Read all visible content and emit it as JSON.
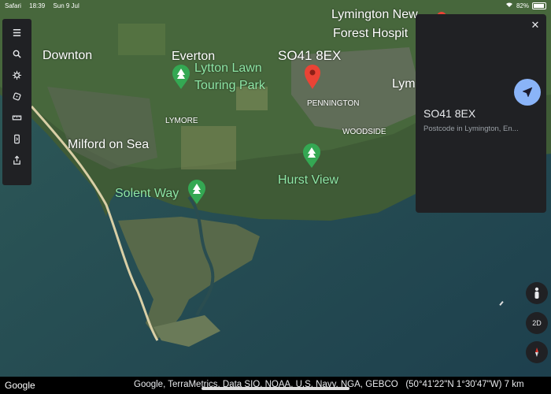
{
  "status_bar": {
    "app": "Safari",
    "time": "18:39",
    "date": "Sun 9 Jul",
    "battery_percent": "82%",
    "battery_level": 0.82
  },
  "toolbar": {
    "icons": [
      "menu-icon",
      "search-icon",
      "voyager-icon",
      "dice-icon",
      "ruler-icon",
      "projects-icon",
      "share-icon"
    ]
  },
  "map_labels": {
    "lymington_hospital_line1": "Lymington New",
    "lymington_hospital_line2": "Forest Hospit",
    "downton": "Downton",
    "everton": "Everton",
    "lytton_lawn_line1": "Lytton Lawn",
    "lytton_lawn_line2": "Touring Park",
    "postcode": "SO41 8EX",
    "lym": "Lym",
    "pennington": "PENNINGTON",
    "lymore": "LYMORE",
    "woodside": "WOODSIDE",
    "milford": "Milford on Sea",
    "solent_way": "Solent Way",
    "hurst_view": "Hurst View"
  },
  "info_panel": {
    "title": "SO41 8EX",
    "subtitle": "Postcode in Lymington, En..."
  },
  "right_controls": {
    "mode_2d": "2D"
  },
  "footer": {
    "logo": "Google",
    "attribution": "Google, TerraMetrics, Data SIO, NOAA, U.S. Navy, NGA, GEBCO",
    "coordinates": "(50°41'22\"N 1°30'47\"W)",
    "scale": "7 km"
  },
  "colors": {
    "panel": "#202124",
    "accent": "#8ab4f8",
    "pin_red": "#ea4335",
    "park_green": "#34a853"
  }
}
